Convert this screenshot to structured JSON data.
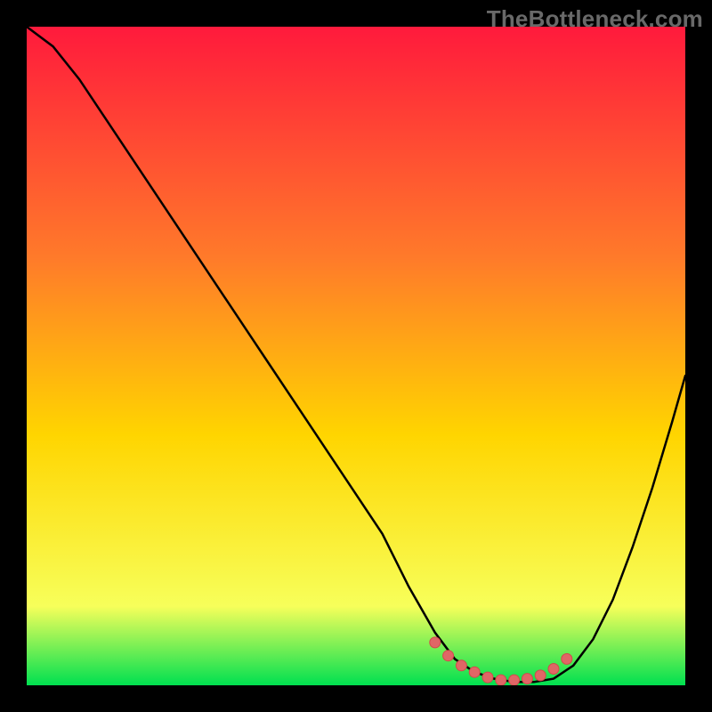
{
  "watermark": "TheBottleneck.com",
  "colors": {
    "page_bg": "#000000",
    "gradient_top": "#ff1a3c",
    "gradient_mid": "#ffd500",
    "gradient_bot": "#00e050",
    "curve": "#000000",
    "marker_fill": "#e06666",
    "marker_stroke": "#d24a4a"
  },
  "chart_data": {
    "type": "line",
    "title": "",
    "xlabel": "",
    "ylabel": "",
    "xlim": [
      0,
      100
    ],
    "ylim": [
      0,
      100
    ],
    "grid": false,
    "legend": false,
    "series": [
      {
        "name": "bottleneck-curve",
        "x": [
          0,
          4,
          8,
          12,
          18,
          24,
          30,
          36,
          42,
          48,
          54,
          58,
          62,
          65,
          68,
          71,
          74,
          77,
          80,
          83,
          86,
          89,
          92,
          95,
          98,
          100
        ],
        "y": [
          100,
          97,
          92,
          86,
          77,
          68,
          59,
          50,
          41,
          32,
          23,
          15,
          8,
          4,
          2,
          1,
          0.5,
          0.5,
          1,
          3,
          7,
          13,
          21,
          30,
          40,
          47
        ]
      }
    ],
    "markers": {
      "name": "trough-markers",
      "x": [
        62,
        64,
        66,
        68,
        70,
        72,
        74,
        76,
        78,
        80,
        82
      ],
      "y": [
        6.5,
        4.5,
        3,
        2,
        1.2,
        0.8,
        0.8,
        1,
        1.5,
        2.5,
        4
      ]
    }
  }
}
